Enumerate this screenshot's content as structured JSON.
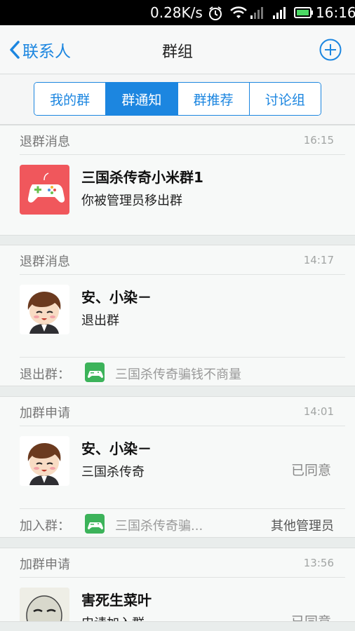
{
  "status_bar": {
    "network_speed": "0.28K/s",
    "time": "16:16"
  },
  "nav": {
    "back_label": "联系人",
    "title": "群组"
  },
  "tabs": [
    {
      "label": "我的群",
      "active": false
    },
    {
      "label": "群通知",
      "active": true
    },
    {
      "label": "群推荐",
      "active": false
    },
    {
      "label": "讨论组",
      "active": false
    }
  ],
  "notifications": [
    {
      "type": "退群消息",
      "time": "16:15",
      "name": "三国杀传奇小米群1",
      "text": "你被管理员移出群"
    },
    {
      "type": "退群消息",
      "time": "14:17",
      "name": "安、小染－",
      "text": "退出群",
      "footer_label": "退出群：",
      "footer_group": "三国杀传奇骗钱不商量"
    },
    {
      "type": "加群申请",
      "time": "14:01",
      "name": "安、小染－",
      "text": "三国杀传奇",
      "status": "已同意",
      "footer_label": "加入群：",
      "footer_group": "三国杀传奇骗...",
      "footer_right": "其他管理员"
    },
    {
      "type": "加群申请",
      "time": "13:56",
      "name": "害死生菜叶",
      "text": "申请加入群",
      "status": "已同意"
    }
  ],
  "colors": {
    "accent": "#1c86e0",
    "game_icon_red": "#f0575c",
    "group_icon_green": "#3cb35a"
  }
}
